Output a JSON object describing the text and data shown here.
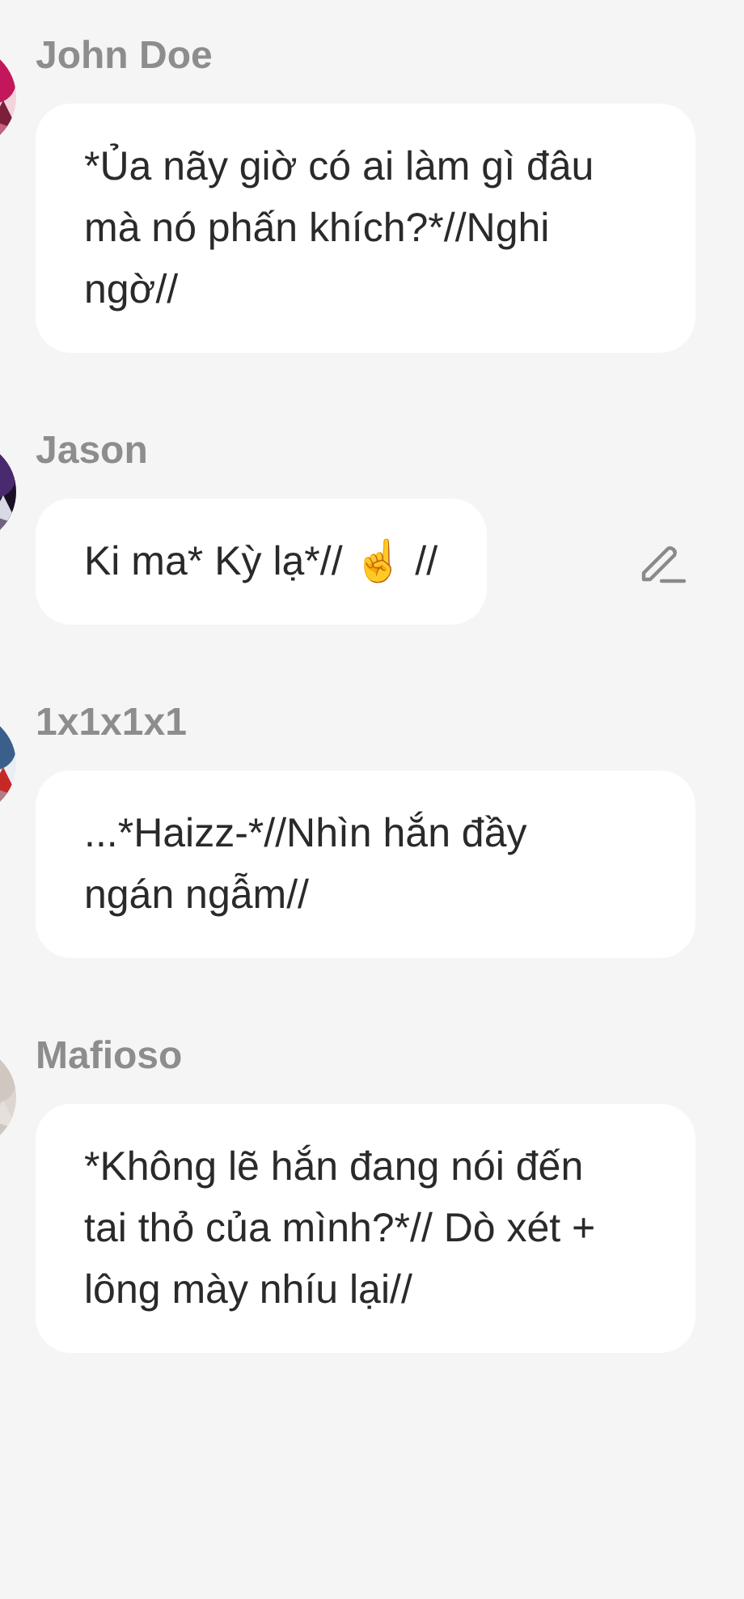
{
  "messages": [
    {
      "author": "John Doe",
      "text": "*Ủa nãy giờ có ai làm gì đâu mà nó phấn khích?*//Nghi ngờ//",
      "editable": false
    },
    {
      "author": "Jason",
      "text": "Ki ma* Kỳ lạ*// ☝️ //",
      "editable": true
    },
    {
      "author": "1x1x1x1",
      "text": "...*Haizz-*//Nhìn hắn đầy ngán ngẫm//",
      "editable": false
    },
    {
      "author": "Mafioso",
      "text": "*Không lẽ hắn đang nói đến tai thỏ của mình?*// Dò xét + lông mày nhíu lại//",
      "editable": false
    }
  ]
}
